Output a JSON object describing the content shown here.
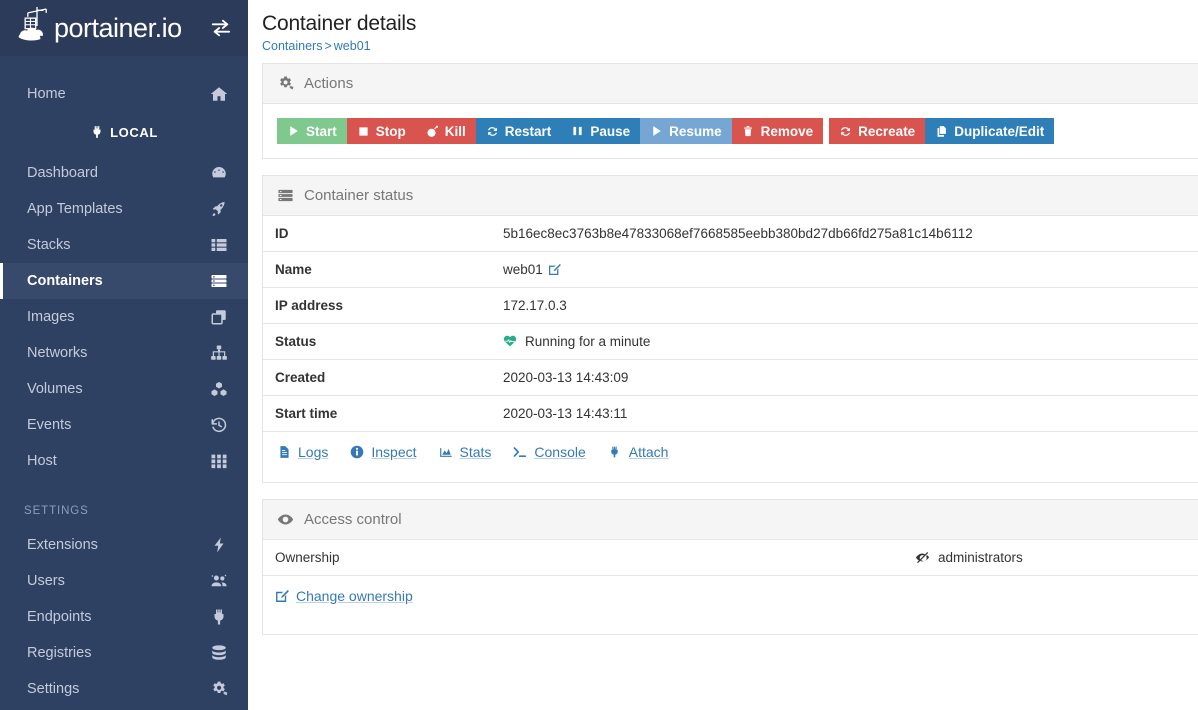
{
  "sidebar": {
    "logo_text": "portainer.io",
    "logo_icon": "portainer-whale-crane-logo",
    "toggle_icon": "exchange-arrows-icon",
    "home": {
      "label": "Home",
      "icon": "home-icon"
    },
    "local_badge": {
      "label": "LOCAL",
      "icon": "plug-icon"
    },
    "items": [
      {
        "label": "Dashboard",
        "icon": "tachometer-icon",
        "active": false
      },
      {
        "label": "App Templates",
        "icon": "rocket-icon",
        "active": false
      },
      {
        "label": "Stacks",
        "icon": "list-icon",
        "active": false
      },
      {
        "label": "Containers",
        "icon": "server-stack-icon",
        "active": true
      },
      {
        "label": "Images",
        "icon": "clone-icon",
        "active": false
      },
      {
        "label": "Networks",
        "icon": "sitemap-icon",
        "active": false
      },
      {
        "label": "Volumes",
        "icon": "cubes-icon",
        "active": false
      },
      {
        "label": "Events",
        "icon": "history-icon",
        "active": false
      },
      {
        "label": "Host",
        "icon": "th-grid-icon",
        "active": false
      }
    ],
    "settings_section_title": "Settings",
    "settings_items": [
      {
        "label": "Extensions",
        "icon": "bolt-icon"
      },
      {
        "label": "Users",
        "icon": "users-icon"
      },
      {
        "label": "Endpoints",
        "icon": "plug-icon"
      },
      {
        "label": "Registries",
        "icon": "database-icon"
      },
      {
        "label": "Settings",
        "icon": "cogs-icon"
      }
    ]
  },
  "header": {
    "title": "Container details",
    "breadcrumb": {
      "root": "Containers",
      "separator": ">",
      "current": "web01"
    }
  },
  "actions_panel": {
    "title": "Actions",
    "icon": "cogs-icon",
    "buttons": [
      {
        "label": "Start",
        "icon": "play-icon",
        "color": "#7fc98e"
      },
      {
        "label": "Stop",
        "icon": "stop-icon",
        "color": "#d9534f"
      },
      {
        "label": "Kill",
        "icon": "bomb-icon",
        "color": "#d9534f"
      },
      {
        "label": "Restart",
        "icon": "sync-icon",
        "color": "#2e7eb8"
      },
      {
        "label": "Pause",
        "icon": "pause-icon",
        "color": "#2e7eb8"
      },
      {
        "label": "Resume",
        "icon": "play-icon",
        "color": "#76a7d4"
      },
      {
        "label": "Remove",
        "icon": "trash-icon",
        "color": "#d9534f"
      },
      {
        "label": "Recreate",
        "icon": "sync-icon",
        "color": "#d9534f",
        "separated": true
      },
      {
        "label": "Duplicate/Edit",
        "icon": "copy-icon",
        "color": "#2e7eb8",
        "separated": true
      }
    ]
  },
  "status_panel": {
    "title": "Container status",
    "icon": "server-stack-icon",
    "rows": [
      {
        "key": "ID",
        "value": "5b16ec8ec3763b8e47833068ef7668585eebb380bd27db66fd275a81c14b6112"
      },
      {
        "key": "Name",
        "value": "web01",
        "edit_icon": "edit-pencil-icon"
      },
      {
        "key": "IP address",
        "value": "172.17.0.3"
      },
      {
        "key": "Status",
        "value": "Running for a minute",
        "status_icon": "heartbeat-icon",
        "status_color": "#23ae89"
      },
      {
        "key": "Created",
        "value": "2020-03-13 14:43:09"
      },
      {
        "key": "Start time",
        "value": "2020-03-13 14:43:11"
      }
    ],
    "links": [
      {
        "label": "Logs",
        "icon": "file-text-icon"
      },
      {
        "label": "Inspect",
        "icon": "info-circle-icon"
      },
      {
        "label": "Stats",
        "icon": "chart-area-icon"
      },
      {
        "label": "Console",
        "icon": "terminal-icon"
      },
      {
        "label": "Attach",
        "icon": "plug-icon"
      }
    ]
  },
  "access_panel": {
    "title": "Access control",
    "icon": "eye-icon",
    "ownership_label": "Ownership",
    "ownership_value": "administrators",
    "ownership_icon": "eye-slash-icon",
    "change_ownership_label": "Change ownership",
    "change_ownership_icon": "edit-pencil-icon"
  },
  "colors": {
    "sidebar_bg": "#2f4162",
    "sidebar_head_bg": "#2c3b5a",
    "sidebar_active_bg": "#384a6b",
    "link_blue": "#337ab7",
    "panel_head_bg": "#f5f5f5",
    "border": "#e4e4e4"
  }
}
